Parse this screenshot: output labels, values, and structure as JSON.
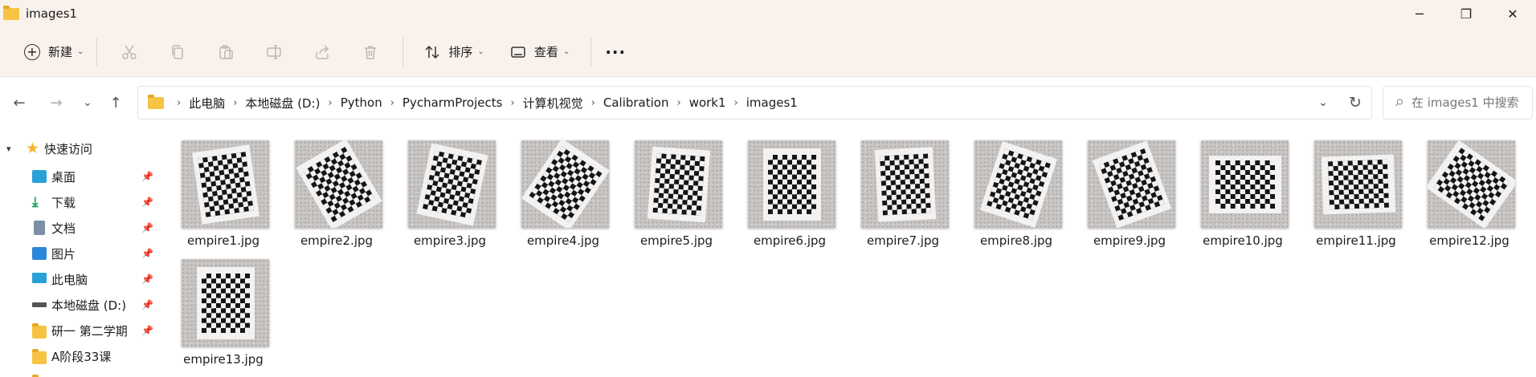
{
  "window": {
    "title": "images1",
    "minimize_glyph": "─",
    "maximize_glyph": "❐",
    "close_glyph": "✕"
  },
  "toolbar": {
    "new_label": "新建",
    "sort_label": "排序",
    "view_label": "查看",
    "more_glyph": "···",
    "disabled_icons": [
      "cut-icon",
      "copy-icon",
      "paste-icon",
      "rename-icon",
      "share-icon",
      "delete-icon"
    ]
  },
  "nav": {
    "back_glyph": "←",
    "forward_glyph": "→",
    "recent_glyph": "⌄",
    "up_glyph": "↑"
  },
  "address": {
    "crumbs": [
      "此电脑",
      "本地磁盘 (D:)",
      "Python",
      "PycharmProjects",
      "计算机视觉",
      "Calibration",
      "work1",
      "images1"
    ],
    "separator": "›",
    "dropdown_glyph": "⌄",
    "refresh_glyph": "↻"
  },
  "search": {
    "placeholder": "在 images1 中搜索"
  },
  "sidebar": {
    "quick_access_label": "快速访问",
    "items": [
      {
        "label": "桌面",
        "icon": "desktop-icon",
        "pinned": true
      },
      {
        "label": "下载",
        "icon": "download-icon",
        "pinned": true
      },
      {
        "label": "文档",
        "icon": "document-icon",
        "pinned": true
      },
      {
        "label": "图片",
        "icon": "pictures-icon",
        "pinned": true
      },
      {
        "label": "此电脑",
        "icon": "computer-icon",
        "pinned": true
      },
      {
        "label": "本地磁盘 (D:)",
        "icon": "drive-icon",
        "pinned": true
      },
      {
        "label": "研一 第二学期",
        "icon": "folder-icon",
        "pinned": true
      },
      {
        "label": "A阶段33课",
        "icon": "folder-icon",
        "pinned": false
      }
    ]
  },
  "files": [
    {
      "name": "empire1.jpg",
      "rotation": -8
    },
    {
      "name": "empire2.jpg",
      "rotation": -30
    },
    {
      "name": "empire3.jpg",
      "rotation": 12
    },
    {
      "name": "empire4.jpg",
      "rotation": 34
    },
    {
      "name": "empire5.jpg",
      "rotation": 4
    },
    {
      "name": "empire6.jpg",
      "rotation": 0
    },
    {
      "name": "empire7.jpg",
      "rotation": -3
    },
    {
      "name": "empire8.jpg",
      "rotation": 18
    },
    {
      "name": "empire9.jpg",
      "rotation": -20
    },
    {
      "name": "empire10.jpg",
      "rotation": 90
    },
    {
      "name": "empire11.jpg",
      "rotation": 88
    },
    {
      "name": "empire12.jpg",
      "rotation": -55
    },
    {
      "name": "empire13.jpg",
      "rotation": 0
    }
  ],
  "colors": {
    "chrome_bg": "#f9f1ec",
    "folder": "#f6c343",
    "star": "#f3b52b"
  }
}
